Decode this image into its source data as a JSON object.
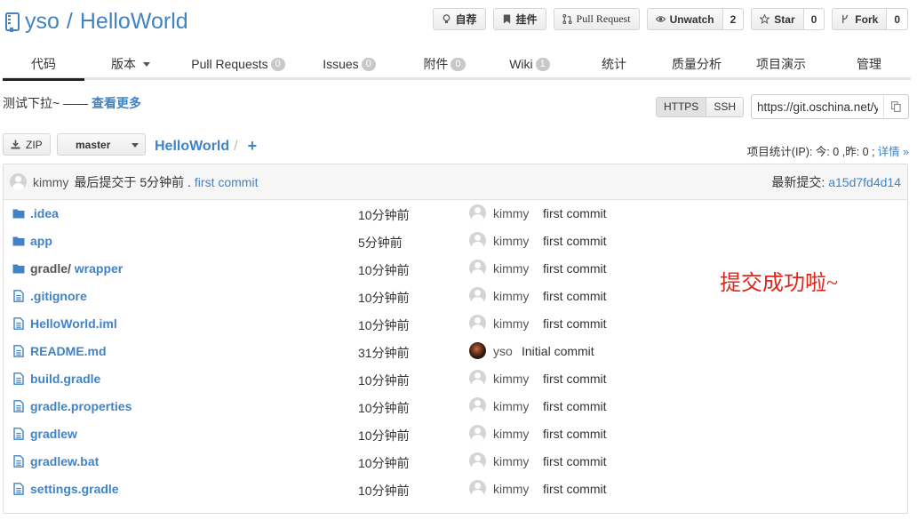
{
  "repo": {
    "owner": "yso",
    "separator": "/",
    "name": "HelloWorld"
  },
  "actions": [
    {
      "key": "collect",
      "icon": "bulb-icon",
      "label": "自荐",
      "count": null
    },
    {
      "key": "pin",
      "icon": "bookmark-icon",
      "label": "挂件",
      "count": null
    },
    {
      "key": "pr",
      "icon": "pull-request-icon",
      "label": "Pull Request",
      "count": null
    },
    {
      "key": "watch",
      "icon": "eye-icon",
      "label": "Unwatch",
      "count": "2"
    },
    {
      "key": "star",
      "icon": "star-icon",
      "label": "Star",
      "count": "0"
    },
    {
      "key": "fork",
      "icon": "fork-icon",
      "label": "Fork",
      "count": "0"
    }
  ],
  "tabs": [
    {
      "label": "代码",
      "count": null
    },
    {
      "label": "版本",
      "count": null
    },
    {
      "label": "Pull Requests",
      "count": "0"
    },
    {
      "label": "Issues",
      "count": "0"
    },
    {
      "label": "附件",
      "count": "0"
    },
    {
      "label": "Wiki",
      "count": "1"
    },
    {
      "label": "统计",
      "count": null
    },
    {
      "label": "质量分析",
      "count": null
    },
    {
      "label": "项目演示",
      "count": null
    },
    {
      "label": "管理",
      "count": null
    }
  ],
  "description": {
    "text": "测试下拉~ —— ",
    "more": "查看更多"
  },
  "clone": {
    "protocols": [
      "HTTPS",
      "SSH"
    ],
    "active": "HTTPS",
    "url": "https://git.oschina.net/yso/HelloWorld.git"
  },
  "toolbar": {
    "zip_label": "ZIP",
    "branch": "master",
    "crumb": "HelloWorld",
    "crumb_sep": "/",
    "plus": "+"
  },
  "stats": {
    "text": "项目统计(IP): 今: 0 ,昨: 0 ;",
    "details": "详情 »"
  },
  "latest_commit": {
    "author": "kimmy",
    "action": "最后提交于 5分钟前 .",
    "message": "first commit",
    "sha_label": "最新提交:",
    "sha": "a15d7fd4d14"
  },
  "files": [
    {
      "type": "folder",
      "name": ".idea",
      "prefix": "",
      "age": "10分钟前",
      "user": "kimmy",
      "message": "first commit",
      "avatar": "default"
    },
    {
      "type": "folder",
      "name": "app",
      "prefix": "",
      "age": "5分钟前",
      "user": "kimmy",
      "message": "first commit",
      "avatar": "default"
    },
    {
      "type": "folder",
      "name": "wrapper",
      "prefix": "gradle/ ",
      "age": "10分钟前",
      "user": "kimmy",
      "message": "first commit",
      "avatar": "default"
    },
    {
      "type": "file",
      "name": ".gitignore",
      "prefix": "",
      "age": "10分钟前",
      "user": "kimmy",
      "message": "first commit",
      "avatar": "default"
    },
    {
      "type": "file",
      "name": "HelloWorld.iml",
      "prefix": "",
      "age": "10分钟前",
      "user": "kimmy",
      "message": "first commit",
      "avatar": "default"
    },
    {
      "type": "file",
      "name": "README.md",
      "prefix": "",
      "age": "31分钟前",
      "user": "yso",
      "message": "Initial commit",
      "avatar": "photo"
    },
    {
      "type": "file",
      "name": "build.gradle",
      "prefix": "",
      "age": "10分钟前",
      "user": "kimmy",
      "message": "first commit",
      "avatar": "default"
    },
    {
      "type": "file",
      "name": "gradle.properties",
      "prefix": "",
      "age": "10分钟前",
      "user": "kimmy",
      "message": "first commit",
      "avatar": "default"
    },
    {
      "type": "file",
      "name": "gradlew",
      "prefix": "",
      "age": "10分钟前",
      "user": "kimmy",
      "message": "first commit",
      "avatar": "default"
    },
    {
      "type": "file",
      "name": "gradlew.bat",
      "prefix": "",
      "age": "10分钟前",
      "user": "kimmy",
      "message": "first commit",
      "avatar": "default"
    },
    {
      "type": "file",
      "name": "settings.gradle",
      "prefix": "",
      "age": "10分钟前",
      "user": "kimmy",
      "message": "first commit",
      "avatar": "default"
    }
  ],
  "annotation": "提交成功啦~",
  "colors": {
    "link": "#4183c4",
    "annotation": "#e0261b",
    "border": "#dddddd"
  }
}
